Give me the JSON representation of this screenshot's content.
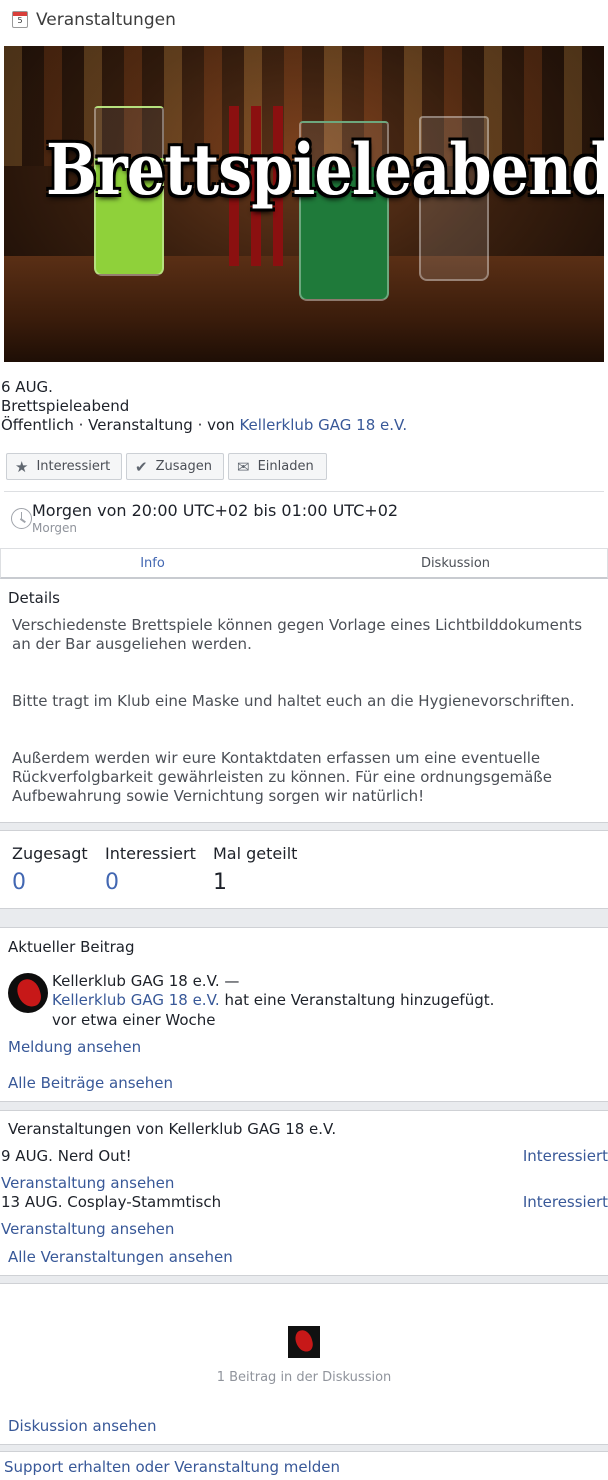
{
  "header": {
    "calendar_day": "5",
    "title": "Veranstaltungen",
    "icon": "calendar-icon"
  },
  "banner": {
    "text": "Brettspieleabend"
  },
  "event": {
    "date": "6 AUG.",
    "title": "Brettspieleabend",
    "meta_prefix": "Öffentlich · Veranstaltung · von ",
    "organizer": "Kellerklub GAG 18 e.V."
  },
  "actions": {
    "interested": {
      "label": "Interessiert",
      "icon": "star-icon"
    },
    "going": {
      "label": "Zusagen",
      "icon": "checkmark-icon"
    },
    "invite": {
      "label": "Einladen",
      "icon": "envelope-icon"
    }
  },
  "time": {
    "main": "Morgen von 20:00 UTC+02 bis 01:00 UTC+02",
    "sub": "Morgen",
    "icon": "clock-icon"
  },
  "tabs": [
    {
      "label": "Info",
      "active": true
    },
    {
      "label": "Diskussion",
      "active": false
    }
  ],
  "details": {
    "heading": "Details",
    "paragraphs": [
      "Verschiedenste Brettspiele können gegen Vorlage eines Lichtbilddokuments an der Bar ausgeliehen werden.",
      "Bitte tragt im Klub eine Maske und haltet euch an die Hygienevorschriften.",
      "Außerdem werden wir eure Kontaktdaten erfassen um eine eventuelle Rückverfolgbarkeit gewährleisten zu können. Für eine ordnungsgemäße Aufbewahrung sowie Vernichtung sorgen wir natürlich!"
    ]
  },
  "stats": [
    {
      "label": "Zugesagt",
      "value": "0"
    },
    {
      "label": "Interessiert",
      "value": "0"
    },
    {
      "label": "Mal geteilt",
      "value": "1"
    }
  ],
  "recent_post": {
    "heading": "Aktueller Beitrag",
    "author": "Kellerklub GAG 18 e.V. —",
    "link_author": "Kellerklub GAG 18 e.V.",
    "action": " hat eine Veranstaltung hinzugefügt.",
    "time": "vor etwa einer Woche",
    "see_post": "Meldung ansehen",
    "all_posts": "Alle Beiträge ansehen"
  },
  "other_events": {
    "heading": "Veranstaltungen von Kellerklub GAG 18 e.V.",
    "items": [
      {
        "date": "9 AUG.",
        "title": "Nerd Out!",
        "status": "Interessiert",
        "link": "Veranstaltung ansehen"
      },
      {
        "date": "13 AUG.",
        "title": "Cosplay-Stammtisch",
        "status": "Interessiert",
        "link": "Veranstaltung ansehen"
      }
    ],
    "all_events": "Alle Veranstaltungen ansehen"
  },
  "discussion": {
    "count": "1 Beitrag in der Diskussion",
    "link": "Diskussion ansehen"
  },
  "footer": {
    "support": "Support erhalten oder Veranstaltung melden"
  }
}
